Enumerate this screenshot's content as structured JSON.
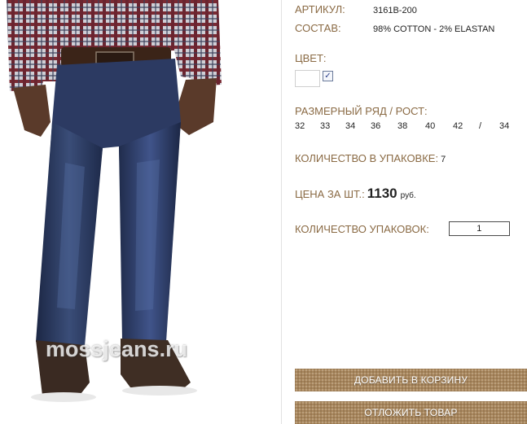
{
  "product": {
    "article_label": "АРТИКУЛ:",
    "article_value": "3161B-200",
    "composition_label": "СОСТАВ:",
    "composition_value": "98% COTTON - 2% ELASTAN",
    "color_label": "ЦВЕТ:",
    "color_swatch": "#ffffff",
    "color_checked": true,
    "size_label": "РАЗМЕРНЫЙ РЯД / РОСТ:",
    "sizes": [
      "32",
      "33",
      "34",
      "36",
      "38",
      "40",
      "42"
    ],
    "size_sep": "/",
    "height": "34",
    "pack_qty_label": "КОЛИЧЕСТВО В УПАКОВКЕ:",
    "pack_qty_value": "7",
    "price_label": "ЦЕНА ЗА ШТ.:",
    "price_value": "1130",
    "price_currency": "руб.",
    "packs_label": "КОЛИЧЕСТВО УПАКОВОК:",
    "packs_value": "1"
  },
  "buttons": {
    "add_to_cart": "ДОБАВИТЬ В КОРЗИНУ",
    "defer": "ОТЛОЖИТЬ ТОВАР"
  },
  "image": {
    "watermark": "mossjeans.ru"
  },
  "colors": {
    "label": "#8a6a44",
    "button": "#a8865c",
    "denim": "#2c3a5c"
  }
}
